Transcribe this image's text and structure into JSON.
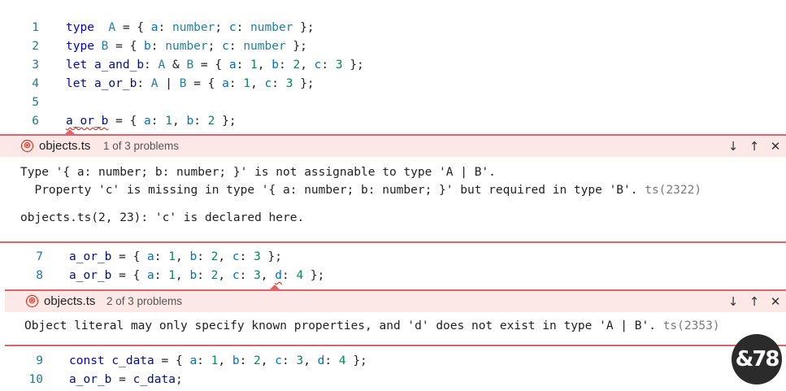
{
  "editor": {
    "lines_top": [
      {
        "num": "1",
        "tokens": [
          [
            "kw",
            "type"
          ],
          [
            "",
            "  "
          ],
          [
            "ty",
            "A"
          ],
          [
            "",
            " = { "
          ],
          [
            "pr",
            "a"
          ],
          [
            "",
            ": "
          ],
          [
            "ty",
            "number"
          ],
          [
            "",
            "; "
          ],
          [
            "pr",
            "c"
          ],
          [
            "",
            ": "
          ],
          [
            "ty",
            "number"
          ],
          [
            "",
            " };"
          ]
        ]
      },
      {
        "num": "2",
        "tokens": [
          [
            "kw",
            "type"
          ],
          [
            "",
            " "
          ],
          [
            "ty",
            "B"
          ],
          [
            "",
            " = { "
          ],
          [
            "pr",
            "b"
          ],
          [
            "",
            ": "
          ],
          [
            "ty",
            "number"
          ],
          [
            "",
            "; "
          ],
          [
            "pr",
            "c"
          ],
          [
            "",
            ": "
          ],
          [
            "ty",
            "number"
          ],
          [
            "",
            " };"
          ]
        ]
      },
      {
        "num": "3",
        "tokens": [
          [
            "kw",
            "let"
          ],
          [
            "",
            " "
          ],
          [
            "vr",
            "a_and_b"
          ],
          [
            "",
            ": "
          ],
          [
            "ty",
            "A"
          ],
          [
            "",
            " & "
          ],
          [
            "ty",
            "B"
          ],
          [
            "",
            " = { "
          ],
          [
            "pr",
            "a"
          ],
          [
            "",
            ": "
          ],
          [
            "nm",
            "1"
          ],
          [
            "",
            ", "
          ],
          [
            "pr",
            "b"
          ],
          [
            "",
            ": "
          ],
          [
            "nm",
            "2"
          ],
          [
            "",
            ", "
          ],
          [
            "pr",
            "c"
          ],
          [
            "",
            ": "
          ],
          [
            "nm",
            "3"
          ],
          [
            "",
            " };"
          ]
        ]
      },
      {
        "num": "4",
        "tokens": [
          [
            "kw",
            "let"
          ],
          [
            "",
            " "
          ],
          [
            "vr",
            "a_or_b"
          ],
          [
            "",
            ": "
          ],
          [
            "ty",
            "A"
          ],
          [
            "",
            " | "
          ],
          [
            "ty",
            "B"
          ],
          [
            "",
            " = { "
          ],
          [
            "pr",
            "a"
          ],
          [
            "",
            ": "
          ],
          [
            "nm",
            "1"
          ],
          [
            "",
            ", "
          ],
          [
            "pr",
            "c"
          ],
          [
            "",
            ": "
          ],
          [
            "nm",
            "3"
          ],
          [
            "",
            " };"
          ]
        ]
      },
      {
        "num": "5",
        "tokens": []
      },
      {
        "num": "6",
        "tokens": [
          [
            "vr squig",
            "a_or_b"
          ],
          [
            "",
            " = { "
          ],
          [
            "pr",
            "a"
          ],
          [
            "",
            ": "
          ],
          [
            "nm",
            "1"
          ],
          [
            "",
            ", "
          ],
          [
            "pr",
            "b"
          ],
          [
            "",
            ": "
          ],
          [
            "nm",
            "2"
          ],
          [
            "",
            " };"
          ]
        ]
      }
    ],
    "lines_mid": [
      {
        "num": "7",
        "tokens": [
          [
            "vr",
            "a_or_b"
          ],
          [
            "",
            " = { "
          ],
          [
            "pr",
            "a"
          ],
          [
            "",
            ": "
          ],
          [
            "nm",
            "1"
          ],
          [
            "",
            ", "
          ],
          [
            "pr",
            "b"
          ],
          [
            "",
            ": "
          ],
          [
            "nm",
            "2"
          ],
          [
            "",
            ", "
          ],
          [
            "pr",
            "c"
          ],
          [
            "",
            ": "
          ],
          [
            "nm",
            "3"
          ],
          [
            "",
            " };"
          ]
        ]
      },
      {
        "num": "8",
        "tokens": [
          [
            "vr",
            "a_or_b"
          ],
          [
            "",
            " = { "
          ],
          [
            "pr",
            "a"
          ],
          [
            "",
            ": "
          ],
          [
            "nm",
            "1"
          ],
          [
            "",
            ", "
          ],
          [
            "pr",
            "b"
          ],
          [
            "",
            ": "
          ],
          [
            "nm",
            "2"
          ],
          [
            "",
            ", "
          ],
          [
            "pr",
            "c"
          ],
          [
            "",
            ": "
          ],
          [
            "nm",
            "3"
          ],
          [
            "",
            ", "
          ],
          [
            "pr squig",
            "d"
          ],
          [
            "",
            ": "
          ],
          [
            "nm",
            "4"
          ],
          [
            "",
            " };"
          ]
        ]
      }
    ],
    "lines_bottom": [
      {
        "num": "9",
        "tokens": [
          [
            "kw",
            "const"
          ],
          [
            "",
            " "
          ],
          [
            "vr",
            "c_data"
          ],
          [
            "",
            " = { "
          ],
          [
            "pr",
            "a"
          ],
          [
            "",
            ": "
          ],
          [
            "nm",
            "1"
          ],
          [
            "",
            ", "
          ],
          [
            "pr",
            "b"
          ],
          [
            "",
            ": "
          ],
          [
            "nm",
            "2"
          ],
          [
            "",
            ", "
          ],
          [
            "pr",
            "c"
          ],
          [
            "",
            ": "
          ],
          [
            "nm",
            "3"
          ],
          [
            "",
            ", "
          ],
          [
            "pr",
            "d"
          ],
          [
            "",
            ": "
          ],
          [
            "nm",
            "4"
          ],
          [
            "",
            " };"
          ]
        ]
      },
      {
        "num": "10",
        "tokens": [
          [
            "vr",
            "a_or_b"
          ],
          [
            "",
            " = "
          ],
          [
            "vr",
            "c_data"
          ],
          [
            "",
            ";"
          ]
        ]
      }
    ]
  },
  "peek1": {
    "filename": "objects.ts",
    "count": "1 of 3 problems",
    "message_line1": "Type '{ a: number; b: number; }' is not assignable to type 'A | B'.",
    "message_line2": "  Property 'c' is missing in type '{ a: number; b: number; }' but required in type 'B'. ",
    "code": "ts(2322)",
    "related": "objects.ts(2, 23): 'c' is declared here."
  },
  "peek2": {
    "filename": "objects.ts",
    "count": "2 of 3 problems",
    "message": "Object literal may only specify known properties, and 'd' does not exist in type 'A | B'. ",
    "code": "ts(2353)"
  },
  "icons": {
    "error": "⊗",
    "next": "↓",
    "prev": "↑",
    "close": "✕"
  },
  "logo": {
    "text": "&78"
  }
}
